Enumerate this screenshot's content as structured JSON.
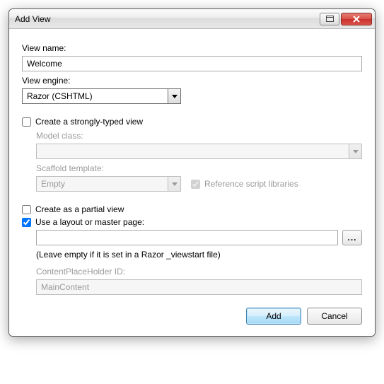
{
  "window": {
    "title": "Add View"
  },
  "labels": {
    "viewName": "View name:",
    "viewEngine": "View engine:",
    "stronglyTyped": "Create a strongly-typed view",
    "modelClass": "Model class:",
    "scaffoldTemplate": "Scaffold template:",
    "referenceScripts": "Reference script libraries",
    "partialView": "Create as a partial view",
    "useLayout": "Use a layout or master page:",
    "layoutHint": "(Leave empty if it is set in a Razor _viewstart file)",
    "contentPlaceholder": "ContentPlaceHolder ID:"
  },
  "values": {
    "viewName": "Welcome",
    "viewEngine": "Razor (CSHTML)",
    "modelClass": "",
    "scaffoldTemplate": "Empty",
    "layoutPath": "",
    "contentPlaceholder": "MainContent",
    "stronglyTypedChecked": false,
    "referenceScriptsChecked": true,
    "partialViewChecked": false,
    "useLayoutChecked": true
  },
  "buttons": {
    "browse": "...",
    "add": "Add",
    "cancel": "Cancel"
  }
}
